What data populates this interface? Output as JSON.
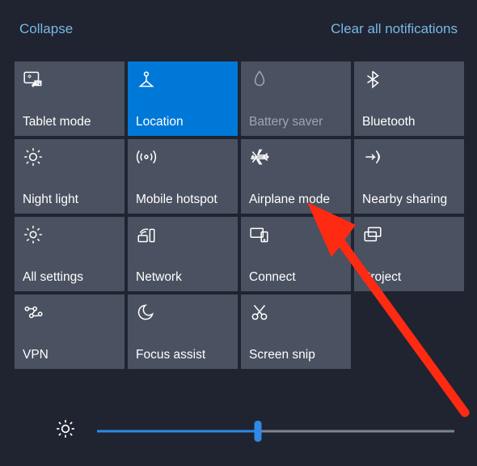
{
  "header": {
    "collapse": "Collapse",
    "clear": "Clear all notifications"
  },
  "tiles": [
    {
      "id": "tablet-mode",
      "label": "Tablet mode",
      "state": "normal"
    },
    {
      "id": "location",
      "label": "Location",
      "state": "active"
    },
    {
      "id": "battery-saver",
      "label": "Battery saver",
      "state": "disabled"
    },
    {
      "id": "bluetooth",
      "label": "Bluetooth",
      "state": "normal"
    },
    {
      "id": "night-light",
      "label": "Night light",
      "state": "normal"
    },
    {
      "id": "mobile-hotspot",
      "label": "Mobile hotspot",
      "state": "normal"
    },
    {
      "id": "airplane-mode",
      "label": "Airplane mode",
      "state": "normal"
    },
    {
      "id": "nearby-sharing",
      "label": "Nearby sharing",
      "state": "normal"
    },
    {
      "id": "all-settings",
      "label": "All settings",
      "state": "normal"
    },
    {
      "id": "network",
      "label": "Network",
      "state": "normal"
    },
    {
      "id": "connect",
      "label": "Connect",
      "state": "normal"
    },
    {
      "id": "project",
      "label": "Project",
      "state": "normal"
    },
    {
      "id": "vpn",
      "label": "VPN",
      "state": "normal"
    },
    {
      "id": "focus-assist",
      "label": "Focus assist",
      "state": "normal"
    },
    {
      "id": "screen-snip",
      "label": "Screen snip",
      "state": "normal"
    }
  ],
  "brightness": {
    "value": 45,
    "min": 0,
    "max": 100
  },
  "annotation": {
    "type": "red-arrow",
    "target_tile": "airplane-mode"
  }
}
